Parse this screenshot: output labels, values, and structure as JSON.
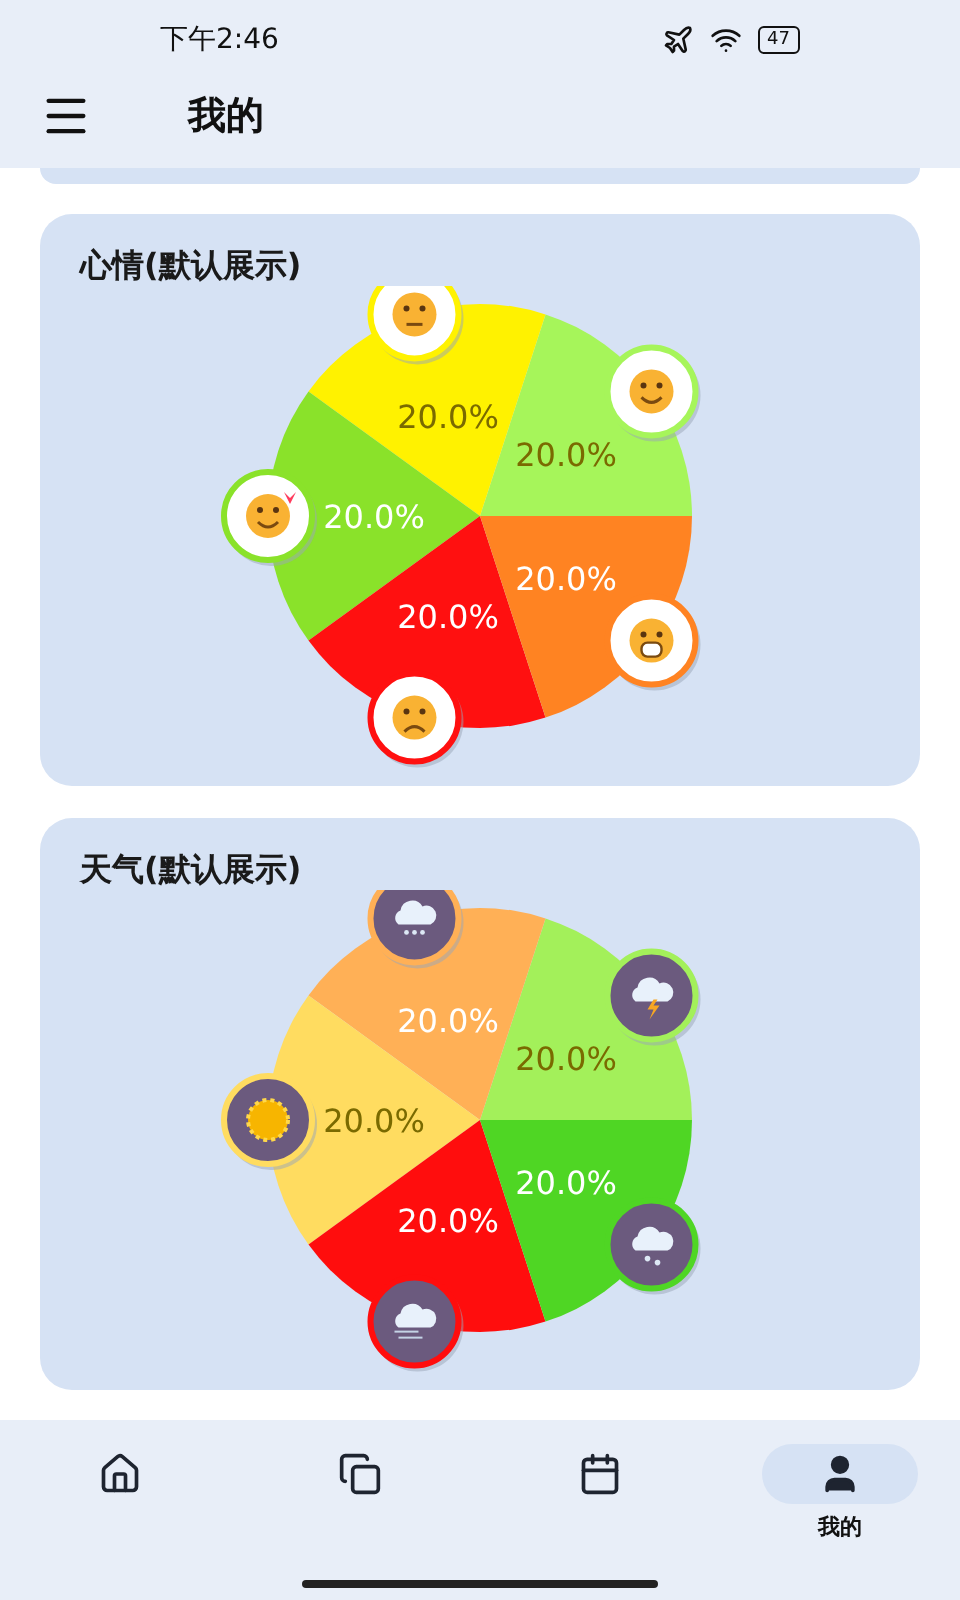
{
  "status_bar": {
    "time": "下午2:46",
    "battery": "47"
  },
  "header": {
    "title": "我的"
  },
  "cards": [
    {
      "title": "心情(默认展示)",
      "kind": "mood",
      "chart_data": {
        "type": "pie",
        "values": [
          20,
          20,
          20,
          20,
          20
        ],
        "value_labels": [
          "20.0%",
          "20.0%",
          "20.0%",
          "20.0%",
          "20.0%"
        ]
      },
      "slices": [
        {
          "color": "#a6f55a",
          "kind": "smile"
        },
        {
          "color": "#fff200",
          "kind": "neutral"
        },
        {
          "color": "#8ae22a",
          "kind": "love"
        },
        {
          "color": "#ff1010",
          "kind": "sad"
        },
        {
          "color": "#ff8322",
          "kind": "cry"
        }
      ]
    },
    {
      "title": "天气(默认展示)",
      "kind": "weather",
      "chart_data": {
        "type": "pie",
        "values": [
          20,
          20,
          20,
          20,
          20
        ],
        "value_labels": [
          "20.0%",
          "20.0%",
          "20.0%",
          "20.0%",
          "20.0%"
        ]
      },
      "slices": [
        {
          "color": "#a3f05a",
          "kind": "thunder"
        },
        {
          "color": "#ffb056",
          "kind": "snow"
        },
        {
          "color": "#ffdc60",
          "kind": "sun"
        },
        {
          "color": "#ff0d0d",
          "kind": "wind"
        },
        {
          "color": "#4fd624",
          "kind": "rain"
        }
      ]
    }
  ],
  "nav": [
    {
      "kind": "home",
      "selected": false
    },
    {
      "kind": "copy",
      "selected": false
    },
    {
      "kind": "calendar",
      "selected": false
    },
    {
      "kind": "user",
      "selected": true,
      "label": "我的"
    }
  ]
}
